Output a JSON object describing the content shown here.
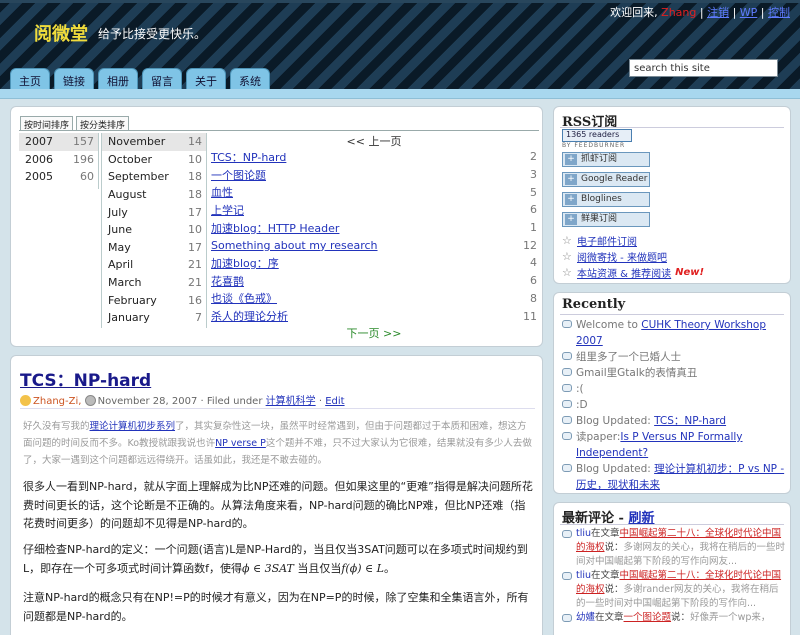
{
  "header": {
    "site_title": "阅微堂",
    "tagline": "给予比接受更快乐。",
    "welcome": "欢迎回来,",
    "user": "Zhang",
    "links": [
      "注销",
      "WP",
      "控制"
    ],
    "search_value": "search this site",
    "tabs": [
      "主页",
      "链接",
      "相册",
      "留言",
      "关于",
      "系统"
    ]
  },
  "archive": {
    "tabs": [
      "按时间排序",
      "按分类排序"
    ],
    "years": [
      {
        "label": "2007",
        "count": "157"
      },
      {
        "label": "2006",
        "count": "196"
      },
      {
        "label": "2005",
        "count": "60"
      }
    ],
    "months": [
      {
        "label": "November",
        "count": "14"
      },
      {
        "label": "October",
        "count": "10"
      },
      {
        "label": "September",
        "count": "18"
      },
      {
        "label": "August",
        "count": "18"
      },
      {
        "label": "July",
        "count": "17"
      },
      {
        "label": "June",
        "count": "10"
      },
      {
        "label": "May",
        "count": "17"
      },
      {
        "label": "April",
        "count": "21"
      },
      {
        "label": "March",
        "count": "21"
      },
      {
        "label": "February",
        "count": "16"
      },
      {
        "label": "January",
        "count": "7"
      }
    ],
    "prev": "<< 上一页",
    "next": "下一页 >>",
    "posts": [
      {
        "title": "TCS：NP-hard",
        "count": "2"
      },
      {
        "title": "一个图论题",
        "count": "3"
      },
      {
        "title": "血性",
        "count": "5"
      },
      {
        "title": "上学记",
        "count": "6"
      },
      {
        "title": "加速blog：HTTP Header",
        "count": "1"
      },
      {
        "title": "Something about my research",
        "count": "12"
      },
      {
        "title": "加速blog：序",
        "count": "4"
      },
      {
        "title": "花喜鹊",
        "count": "6"
      },
      {
        "title": "也谈《色戒》",
        "count": "8"
      },
      {
        "title": "杀人的理论分析",
        "count": "11"
      }
    ]
  },
  "post": {
    "title": "TCS：NP-hard",
    "author": "Zhang-Zi,",
    "date": "November 28, 2007",
    "filed": "· Filed under",
    "category": "计算机科学",
    "sep": "·",
    "edit": "Edit",
    "p1_a": "好久没有写我的",
    "p1_link1": "理论计算机初步系列",
    "p1_b": "了，其实复杂性这一块，虽然平时经常遇到，但由于问题都过于本质和困难，想这方面问题的时间反而不多。Ko教授就跟我说也许",
    "p1_link2": "NP verse P",
    "p1_c": "这个题并不难，只不过大家认为它很难，结果就没有多少人去做了，大家一遇到这个问题都远远得绕开。话虽如此，我还是不敢去碰的。",
    "p2": "很多人一看到NP-hard，就从字面上理解成为比NP还难的问题。但如果这里的“更难”指得是解决问题所花费时间更长的话，这个论断是不正确的。从算法角度来看，NP-hard问题的确比NP难，但比NP还难（指花费时间更多）的问题却不见得是NP-hard的。",
    "p3_a": "仔细检查NP-hard的定义：一个问题(语言)L是NP-Hard的，当且仅当3SAT问题可以在多项式时间规约到L，即存在一个可多项式时间计算函数f，使得",
    "p3_m1": "ϕ ∈ 3SAT",
    "p3_b": " 当且仅当",
    "p3_m2": "f(ϕ) ∈ L",
    "p3_c": "。",
    "p4": "注意NP-hard的概念只有在NP!=P的时候才有意义，因为在NP=P的时候，除了空集和全集语言外，所有问题都是NP-hard的。"
  },
  "rss": {
    "title": "RSS订阅",
    "badge": "1365 readers",
    "feedburner": "BY FEEDBURNER",
    "buttons": [
      "抓虾订阅",
      "Google Reader",
      "Bloglines",
      "鲜果订阅"
    ],
    "links": [
      "电子邮件订阅",
      "阅微寄找 - 来做题吧",
      "本站资源 & 推荐阅读"
    ],
    "new_tag": "New!"
  },
  "recent": {
    "title": "Recently",
    "items": [
      {
        "pre": "Welcome to ",
        "link": "CUHK Theory Workshop 2007",
        "post": ""
      },
      {
        "pre": "组里多了一个已婚人士",
        "link": "",
        "post": ""
      },
      {
        "pre": "Gmail里Gtalk的表情真丑",
        "link": "",
        "post": ""
      },
      {
        "pre": ":(",
        "link": "",
        "post": ""
      },
      {
        "pre": ":D",
        "link": "",
        "post": ""
      },
      {
        "pre": "Blog Updated: ",
        "link": "TCS：NP-hard",
        "post": ""
      },
      {
        "pre": "读paper:",
        "link": "Is P Versus NP Formally Independent?",
        "post": ""
      },
      {
        "pre": "Blog Updated: ",
        "link": "理论计算机初步：P vs NP - 历史，现状和未来",
        "post": ""
      }
    ]
  },
  "comments": {
    "title": "最新评论 - ",
    "refresh": "刷新",
    "items": [
      {
        "who": "tliu",
        "mid": "在文章",
        "post": "中国崛起第二十八：全球化时代论中国的海权",
        "says": "说：",
        "excerpt": "多谢网友的关心，我将在稍后的一些时间对中国崛起第下阶段的写作向网友..."
      },
      {
        "who": "tliu",
        "mid": "在文章",
        "post": "中国崛起第二十八：全球化时代论中国的海权",
        "says": "说：",
        "excerpt": "多谢rander网友的关心，我将在稍后的一些时间对中国崛起第下阶段的写作向..."
      },
      {
        "who": "幼嫿",
        "mid": "在文章",
        "post": "一个图论题",
        "says": "说：",
        "excerpt": "好像弄一个wp来，"
      }
    ]
  },
  "colors": {
    "title_yellow": "#f0dc3c",
    "tab_blue": "#7fc4e6",
    "link_blue": "#2233bb",
    "accent_red": "#e02020",
    "bg": "#d4e3ea"
  }
}
